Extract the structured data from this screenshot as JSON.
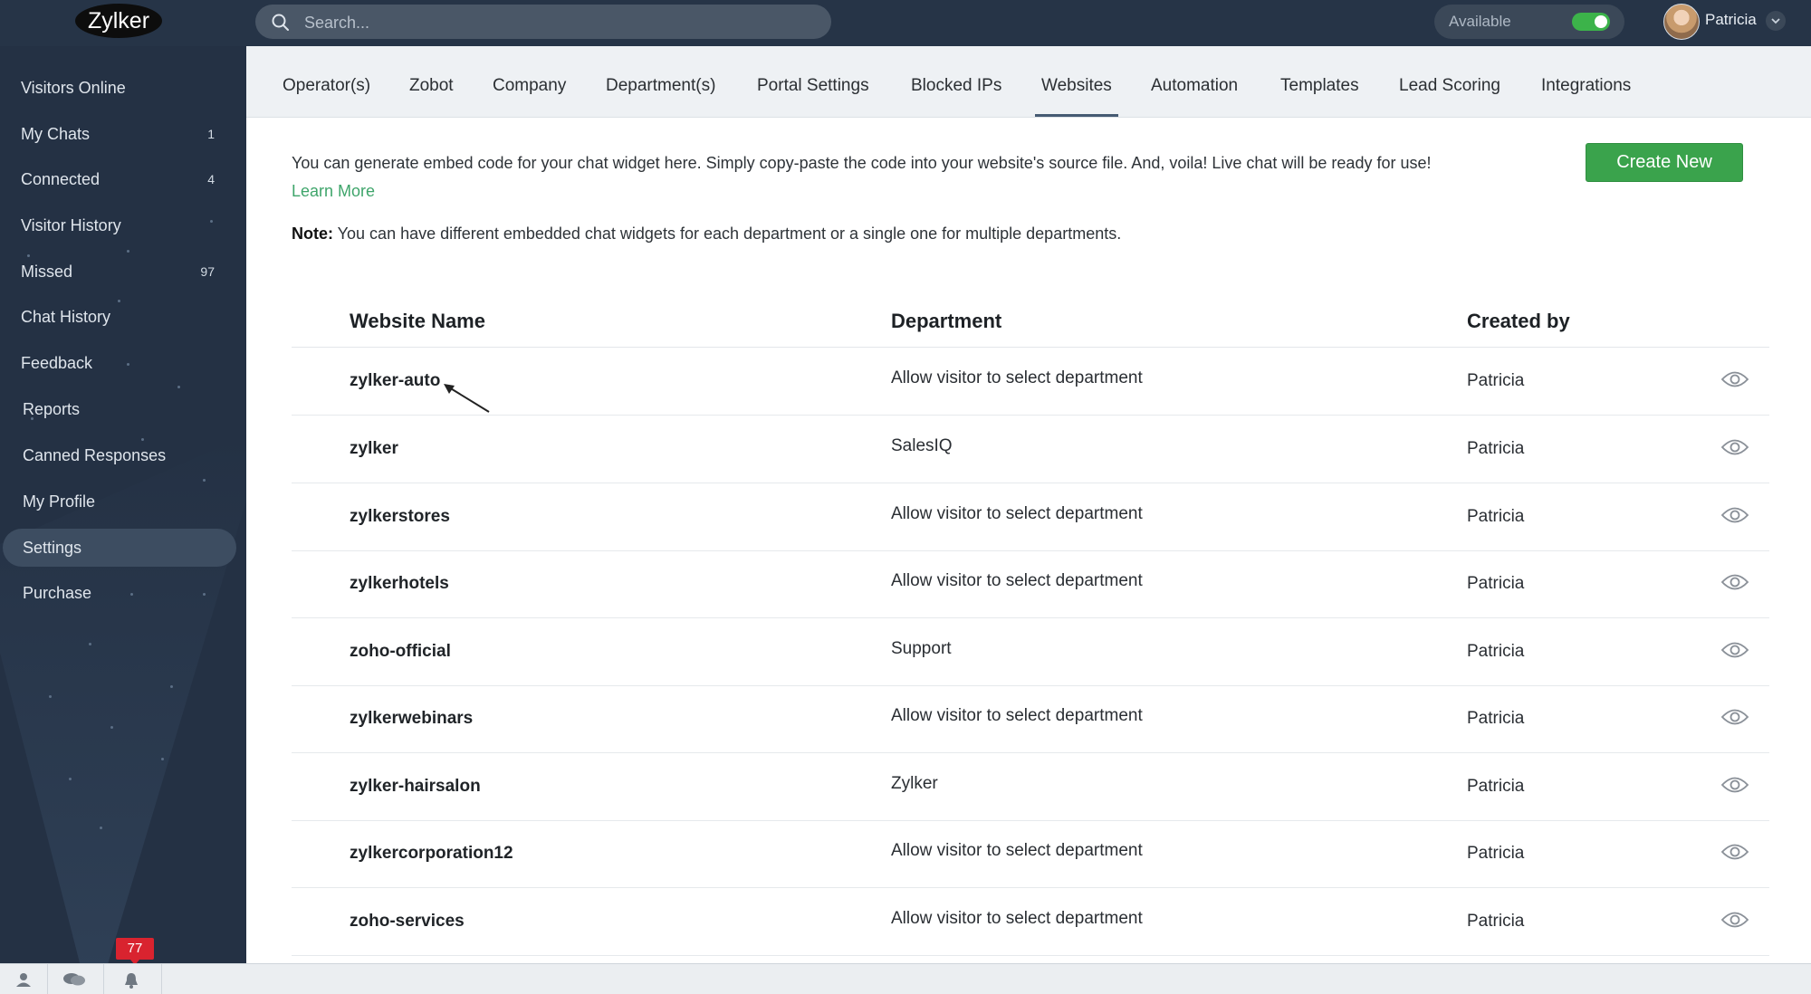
{
  "header": {
    "logo": "Zylker",
    "search_placeholder": "Search...",
    "status_label": "Available",
    "user_name": "Patricia"
  },
  "sidebar": {
    "items": [
      {
        "label": "Visitors Online",
        "count": ""
      },
      {
        "label": "My Chats",
        "count": "1"
      },
      {
        "label": "Connected",
        "count": "4"
      },
      {
        "label": "Visitor History",
        "count": ""
      },
      {
        "label": "Missed",
        "count": "97"
      },
      {
        "label": "Chat History",
        "count": ""
      },
      {
        "label": "Feedback",
        "count": ""
      },
      {
        "label": "Reports",
        "count": ""
      },
      {
        "label": "Canned Responses",
        "count": ""
      },
      {
        "label": "My Profile",
        "count": ""
      },
      {
        "label": "Settings",
        "count": ""
      },
      {
        "label": "Purchase",
        "count": ""
      }
    ],
    "active": "Settings"
  },
  "tabs": [
    "Operator(s)",
    "Zobot",
    "Company",
    "Department(s)",
    "Portal Settings",
    "Blocked IPs",
    "Websites",
    "Automation",
    "Templates",
    "Lead Scoring",
    "Integrations"
  ],
  "active_tab": "Websites",
  "intro": {
    "text": "You can generate embed code for your chat widget here. Simply copy-paste the code into your website's source file. And, voila! Live chat will be ready for use! ",
    "link": "Learn More",
    "note_label": "Note:",
    "note_text": " You can have different embedded chat widgets for each department or a single one for multiple departments."
  },
  "create_button": "Create New",
  "table": {
    "columns": [
      "Website Name",
      "Department",
      "Created by"
    ],
    "rows": [
      {
        "name": "zylker-auto",
        "department": "Allow visitor to select department",
        "created_by": "Patricia"
      },
      {
        "name": "zylker",
        "department": "SalesIQ",
        "created_by": "Patricia"
      },
      {
        "name": "zylkerstores",
        "department": "Allow visitor to select department",
        "created_by": "Patricia"
      },
      {
        "name": "zylkerhotels",
        "department": "Allow visitor to select department",
        "created_by": "Patricia"
      },
      {
        "name": "zoho-official",
        "department": "Support",
        "created_by": "Patricia"
      },
      {
        "name": "zylkerwebinars",
        "department": "Allow visitor to select department",
        "created_by": "Patricia"
      },
      {
        "name": "zylker-hairsalon",
        "department": "Zylker",
        "created_by": "Patricia"
      },
      {
        "name": "zylkercorporation12",
        "department": "Allow visitor to select department",
        "created_by": "Patricia"
      },
      {
        "name": "zoho-services",
        "department": "Allow visitor to select department",
        "created_by": "Patricia"
      }
    ]
  },
  "tray": {
    "notification_count": "77",
    "icons": [
      "user-icon",
      "chat-bubbles-icon",
      "bell-icon"
    ]
  },
  "colors": {
    "sidebar_bg": "#243144",
    "topbar_bg": "#263447",
    "accent_green": "#3aa34c",
    "link_green": "#3fa56b",
    "badge_red": "#d9232f"
  }
}
